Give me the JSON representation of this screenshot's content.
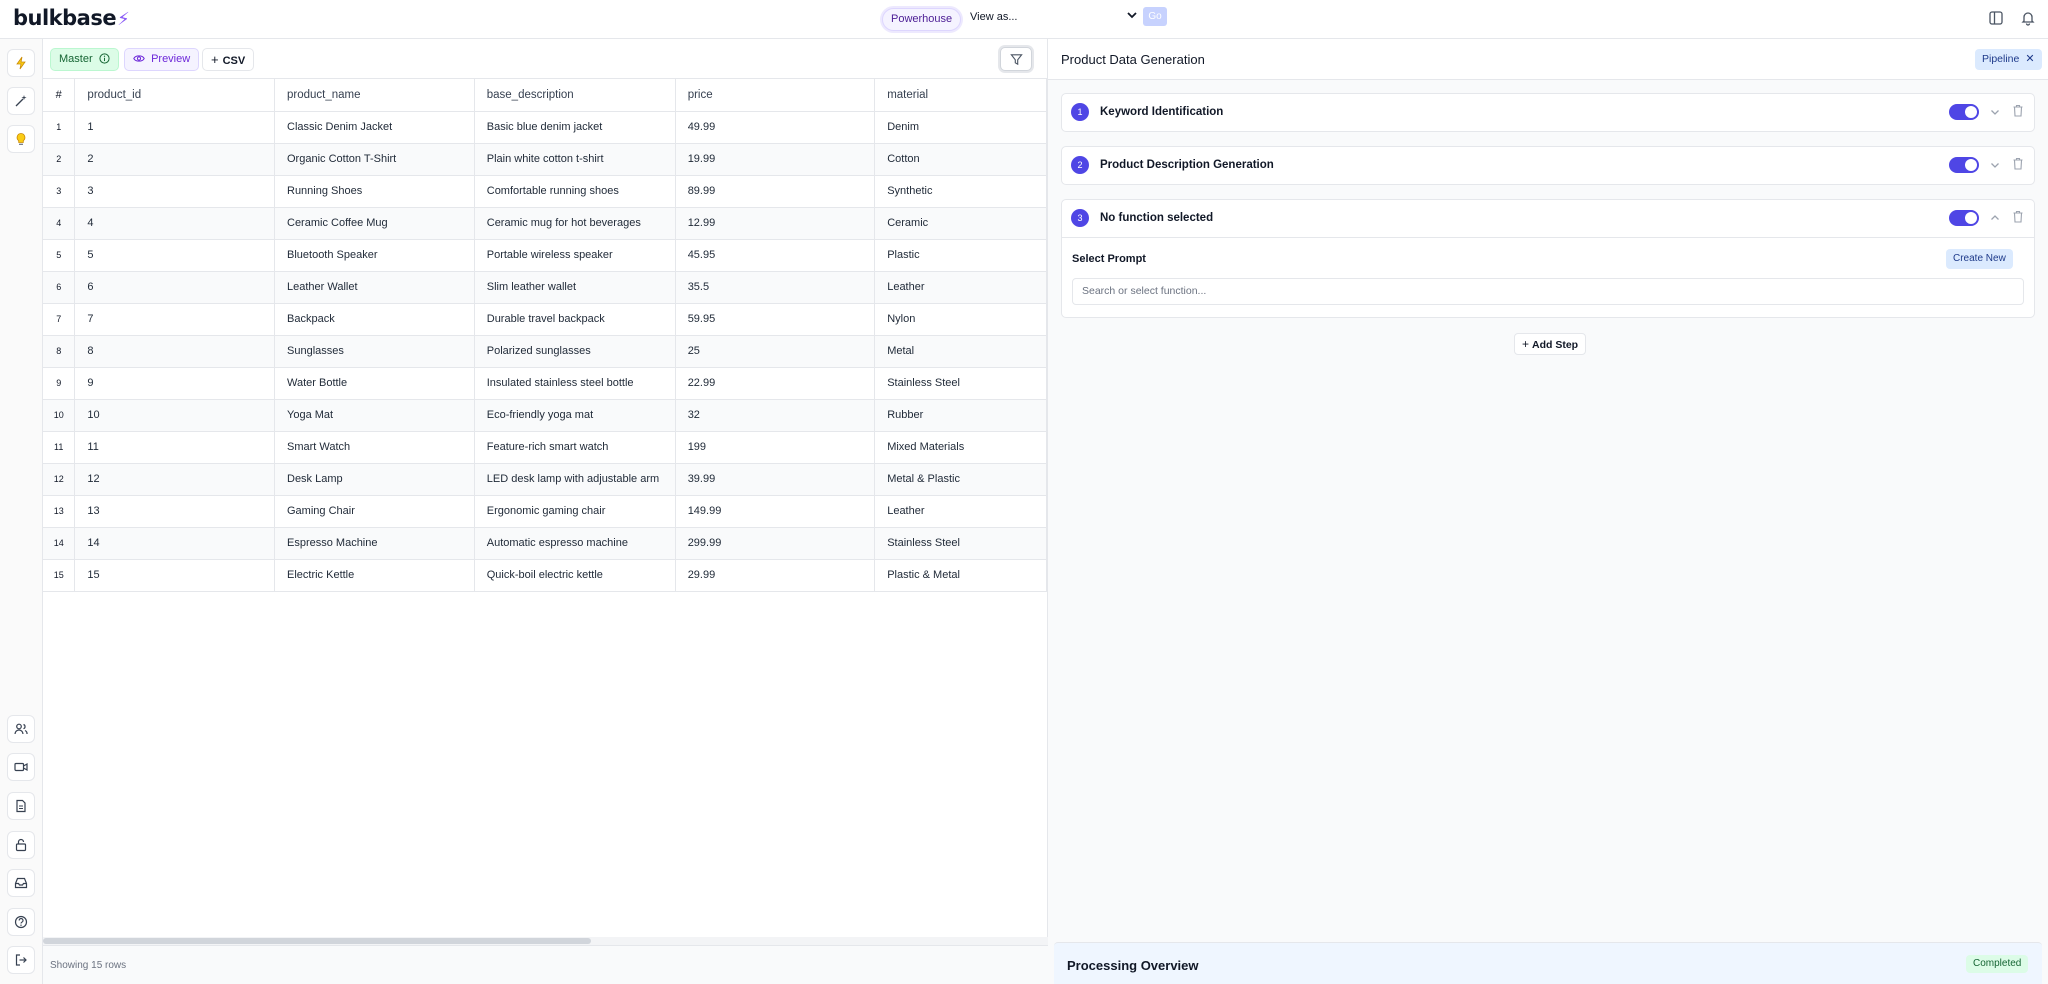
{
  "app": {
    "logo_text": "bulkbase",
    "brand_color": "#8b5cf6",
    "accent_color": "#4f46e5"
  },
  "topbar": {
    "workspace": "Powerhouse",
    "view_as_placeholder": "View as...",
    "go_label": "Go",
    "icons": [
      "panel-icon",
      "bell-icon"
    ]
  },
  "rail": {
    "top_icons": [
      "bolt-icon",
      "wand-icon",
      "lightbulb-icon"
    ],
    "bottom_icons": [
      "users-icon",
      "video-icon",
      "document-icon",
      "lock-icon",
      "inbox-icon",
      "help-icon",
      "logout-icon"
    ]
  },
  "toolbar": {
    "master_label": "Master",
    "preview_label": "Preview",
    "csv_label": "CSV"
  },
  "table": {
    "columns": [
      "#",
      "product_id",
      "product_name",
      "base_description",
      "price",
      "material"
    ],
    "rows": [
      [
        "1",
        "1",
        "Classic Denim Jacket",
        "Basic blue denim jacket",
        "49.99",
        "Denim"
      ],
      [
        "2",
        "2",
        "Organic Cotton T-Shirt",
        "Plain white cotton t-shirt",
        "19.99",
        "Cotton"
      ],
      [
        "3",
        "3",
        "Running Shoes",
        "Comfortable running shoes",
        "89.99",
        "Synthetic"
      ],
      [
        "4",
        "4",
        "Ceramic Coffee Mug",
        "Ceramic mug for hot beverages",
        "12.99",
        "Ceramic"
      ],
      [
        "5",
        "5",
        "Bluetooth Speaker",
        "Portable wireless speaker",
        "45.95",
        "Plastic"
      ],
      [
        "6",
        "6",
        "Leather Wallet",
        "Slim leather wallet",
        "35.5",
        "Leather"
      ],
      [
        "7",
        "7",
        "Backpack",
        "Durable travel backpack",
        "59.95",
        "Nylon"
      ],
      [
        "8",
        "8",
        "Sunglasses",
        "Polarized sunglasses",
        "25",
        "Metal"
      ],
      [
        "9",
        "9",
        "Water Bottle",
        "Insulated stainless steel bottle",
        "22.99",
        "Stainless Steel"
      ],
      [
        "10",
        "10",
        "Yoga Mat",
        "Eco-friendly yoga mat",
        "32",
        "Rubber"
      ],
      [
        "11",
        "11",
        "Smart Watch",
        "Feature-rich smart watch",
        "199",
        "Mixed Materials"
      ],
      [
        "12",
        "12",
        "Desk Lamp",
        "LED desk lamp with adjustable arm",
        "39.99",
        "Metal & Plastic"
      ],
      [
        "13",
        "13",
        "Gaming Chair",
        "Ergonomic gaming chair",
        "149.99",
        "Leather"
      ],
      [
        "14",
        "14",
        "Espresso Machine",
        "Automatic espresso machine",
        "299.99",
        "Stainless Steel"
      ],
      [
        "15",
        "15",
        "Electric Kettle",
        "Quick-boil electric kettle",
        "29.99",
        "Plastic & Metal"
      ]
    ],
    "footer_text": "Showing 15 rows"
  },
  "panel": {
    "title": "Product Data Generation",
    "pipeline_label": "Pipeline",
    "steps": [
      {
        "num": "1",
        "title": "Keyword Identification",
        "enabled": true,
        "expanded": false
      },
      {
        "num": "2",
        "title": "Product Description Generation",
        "enabled": true,
        "expanded": false
      },
      {
        "num": "3",
        "title": "No function selected",
        "enabled": true,
        "expanded": true
      }
    ],
    "select_prompt_label": "Select Prompt",
    "create_new_label": "Create New",
    "function_search_placeholder": "Search or select function...",
    "add_step_label": "Add Step",
    "overview_title": "Processing Overview",
    "overview_status": "Completed"
  }
}
